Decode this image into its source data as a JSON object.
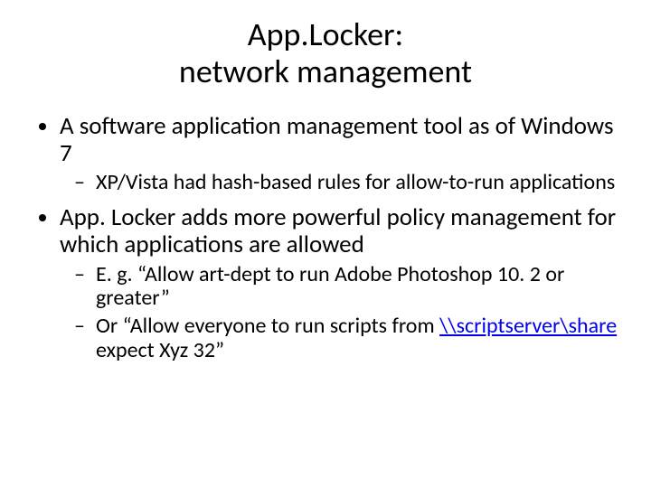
{
  "title_line1": "App.Locker:",
  "title_line2": "network management",
  "bullets": {
    "b1": "A software application management tool as of Windows 7",
    "b1_sub1": "XP/Vista had hash-based rules for allow-to-run applications",
    "b2": "App. Locker adds more powerful policy management for which applications are allowed",
    "b2_sub1": "E. g. “Allow art-dept to run Adobe Photoshop 10. 2 or greater”",
    "b2_sub2_prefix": "Or “Allow everyone to run scripts from ",
    "b2_sub2_link": "\\\\scriptserver\\share",
    "b2_sub2_suffix": " expect Xyz 32”"
  }
}
